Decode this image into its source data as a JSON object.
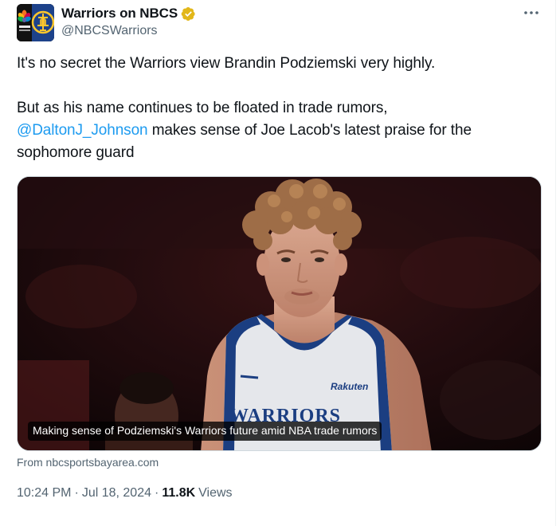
{
  "author": {
    "display_name": "Warriors on NBCS",
    "handle": "@NBCSWarriors",
    "verified_badge_color": "#e2b719"
  },
  "more_menu": {
    "icon": "more-horizontal-icon"
  },
  "tweet": {
    "paragraph_1": "It's no secret the Warriors view Brandin Podziemski very highly.",
    "paragraph_2_prefix": "But as his name continues to be floated in trade rumors,",
    "mention": "@DaltonJ_Johnson",
    "paragraph_2_suffix": " makes sense of Joe Lacob's latest praise for the sophomore guard"
  },
  "link_card": {
    "caption": "Making sense of Podziemski's Warriors future amid NBA trade rumors",
    "source": "From nbcsportsbayarea.com",
    "jersey_sponsor": "Rakuten",
    "jersey_text": "WARRIORS"
  },
  "meta": {
    "time": "10:24 PM",
    "separator": "·",
    "date": "Jul 18, 2024",
    "views_count": "11.8K",
    "views_label": "Views"
  },
  "colors": {
    "link_blue": "#1d9bf0",
    "secondary_text": "#536471",
    "primary_text": "#0f1419"
  }
}
